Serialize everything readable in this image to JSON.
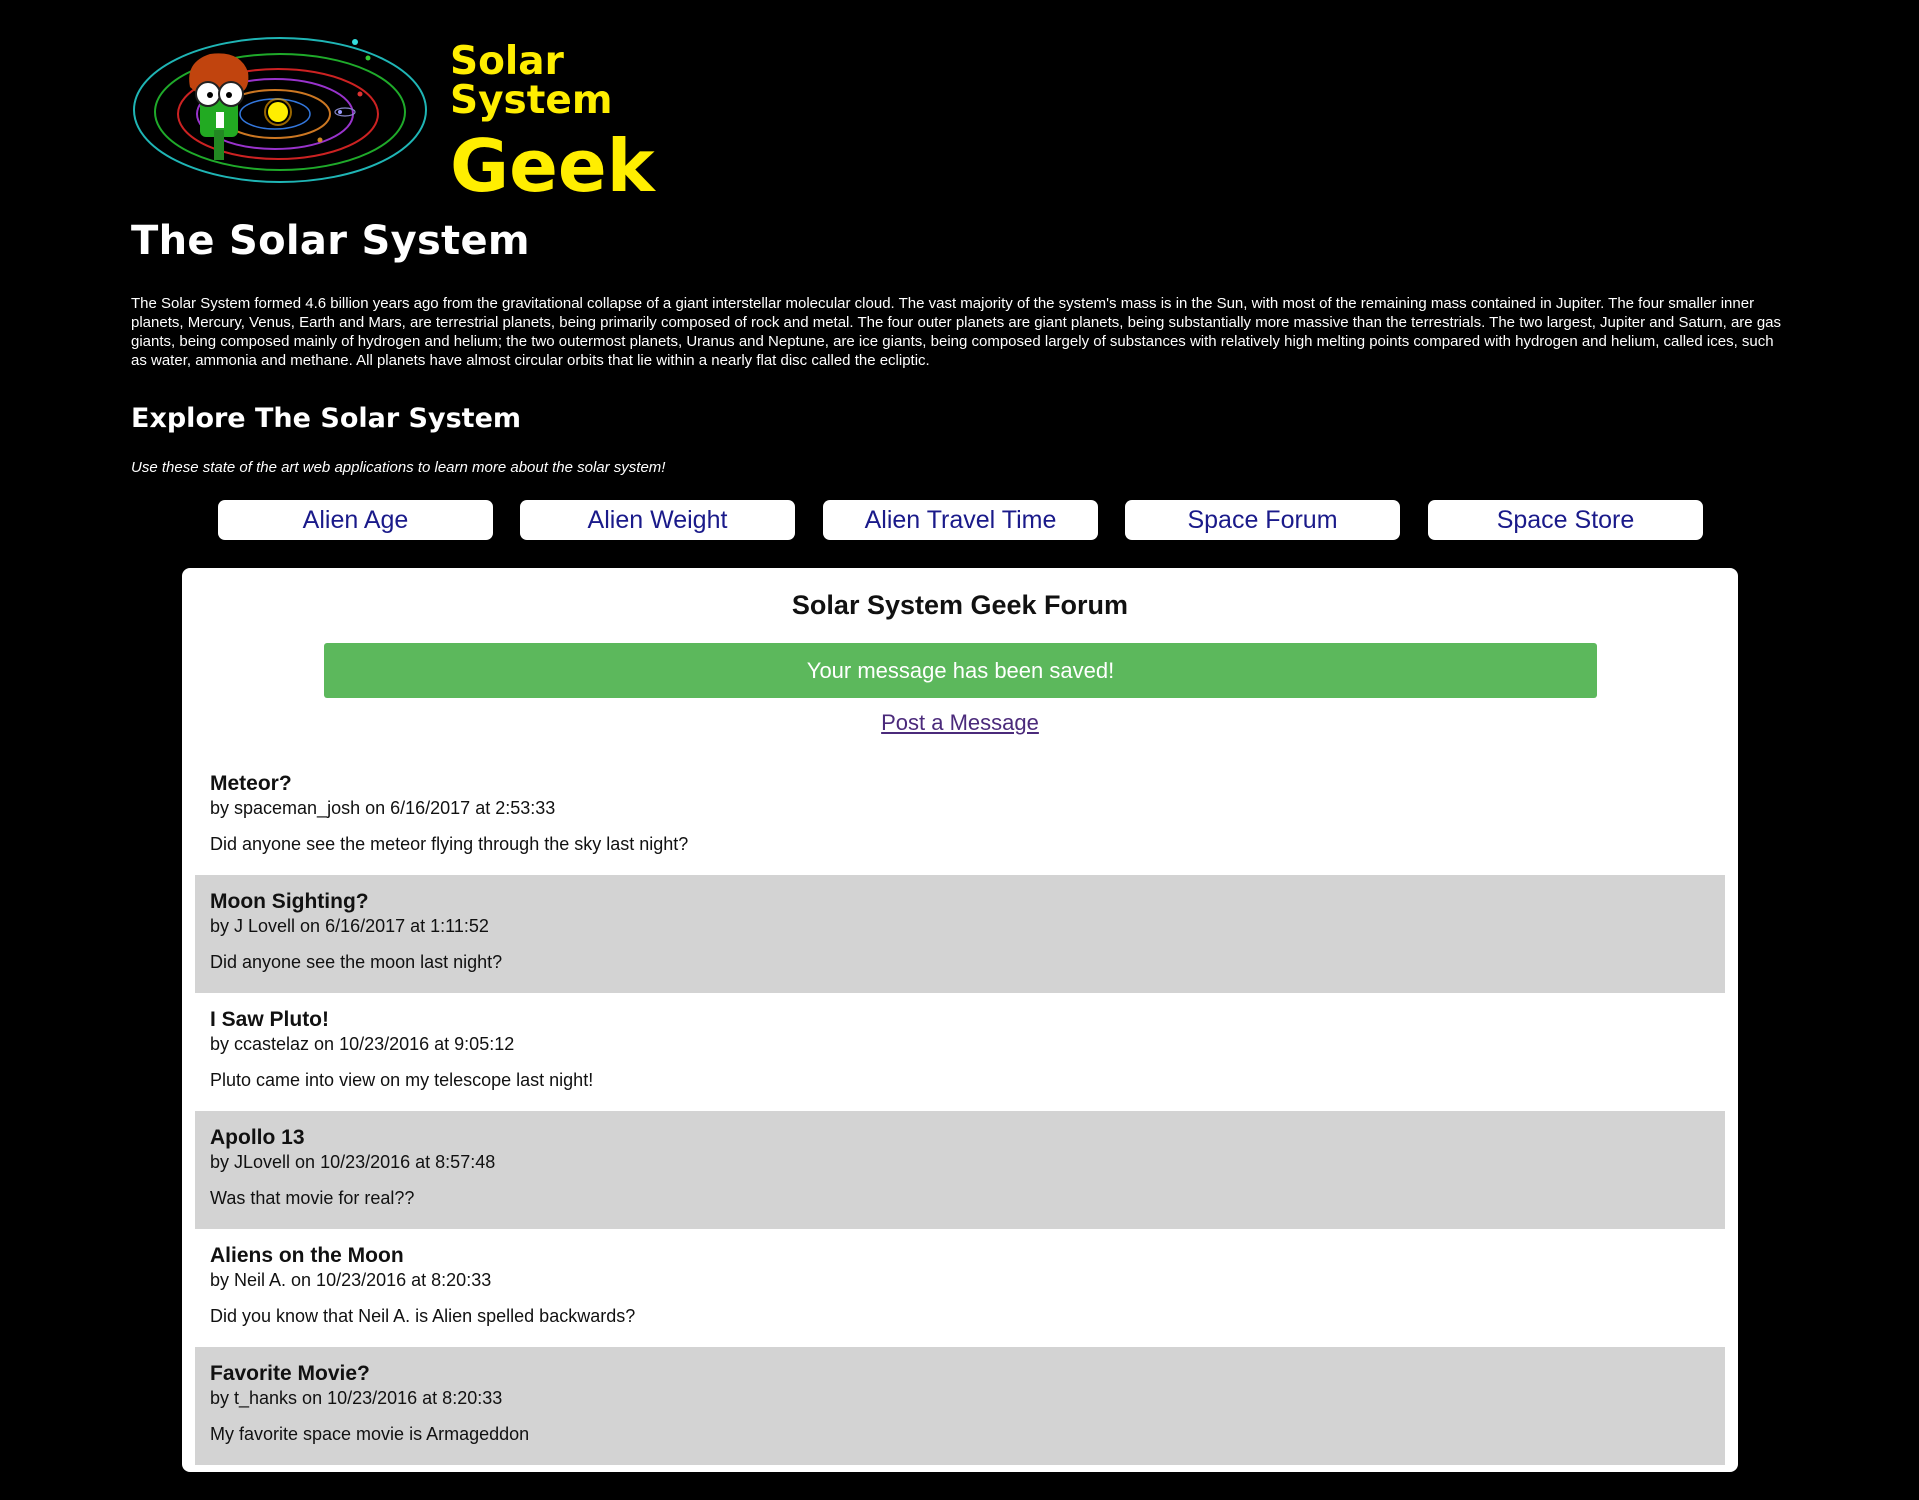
{
  "header": {
    "logo_line1": "Solar System",
    "logo_line2": "Geek"
  },
  "page_title": "The Solar System",
  "intro": "The Solar System formed 4.6 billion years ago from the gravitational collapse of a giant interstellar molecular cloud. The vast majority of the system's mass is in the Sun, with most of the remaining mass contained in Jupiter. The four smaller inner planets, Mercury, Venus, Earth and Mars, are terrestrial planets, being primarily composed of rock and metal. The four outer planets are giant planets, being substantially more massive than the terrestrials. The two largest, Jupiter and Saturn, are gas giants, being composed mainly of hydrogen and helium; the two outermost planets, Uranus and Neptune, are ice giants, being composed largely of substances with relatively high melting points compared with hydrogen and helium, called ices, such as water, ammonia and methane. All planets have almost circular orbits that lie within a nearly flat disc called the ecliptic.",
  "explore": {
    "heading": "Explore The Solar System",
    "subtitle": "Use these state of the art web applications to learn more about the solar system!"
  },
  "nav": [
    {
      "label": "Alien Age"
    },
    {
      "label": "Alien Weight"
    },
    {
      "label": "Alien Travel Time"
    },
    {
      "label": "Space Forum"
    },
    {
      "label": "Space Store"
    }
  ],
  "forum": {
    "title": "Solar System Geek Forum",
    "success_message": "Your message has been saved!",
    "post_link": "Post a Message",
    "posts": [
      {
        "title": "Meteor?",
        "meta": "by spaceman_josh on 6/16/2017 at 2:53:33",
        "body": "Did anyone see the meteor flying through the sky last night?"
      },
      {
        "title": "Moon Sighting?",
        "meta": "by J Lovell on 6/16/2017 at 1:11:52",
        "body": "Did anyone see the moon last night?"
      },
      {
        "title": "I Saw Pluto!",
        "meta": "by ccastelaz on 10/23/2016 at 9:05:12",
        "body": "Pluto came into view on my telescope last night!"
      },
      {
        "title": "Apollo 13",
        "meta": "by JLovell on 10/23/2016 at 8:57:48",
        "body": "Was that movie for real??"
      },
      {
        "title": "Aliens on the Moon",
        "meta": "by Neil A. on 10/23/2016 at 8:20:33",
        "body": "Did you know that Neil A. is Alien spelled backwards?"
      },
      {
        "title": "Favorite Movie?",
        "meta": "by t_hanks on 10/23/2016 at 8:20:33",
        "body": "My favorite space movie is Armageddon"
      }
    ]
  },
  "colors": {
    "background": "#000000",
    "logo_text": "#ffee00",
    "nav_text": "#1a1a8a",
    "success": "#5cb85c",
    "alt_row": "#d3d3d3"
  }
}
